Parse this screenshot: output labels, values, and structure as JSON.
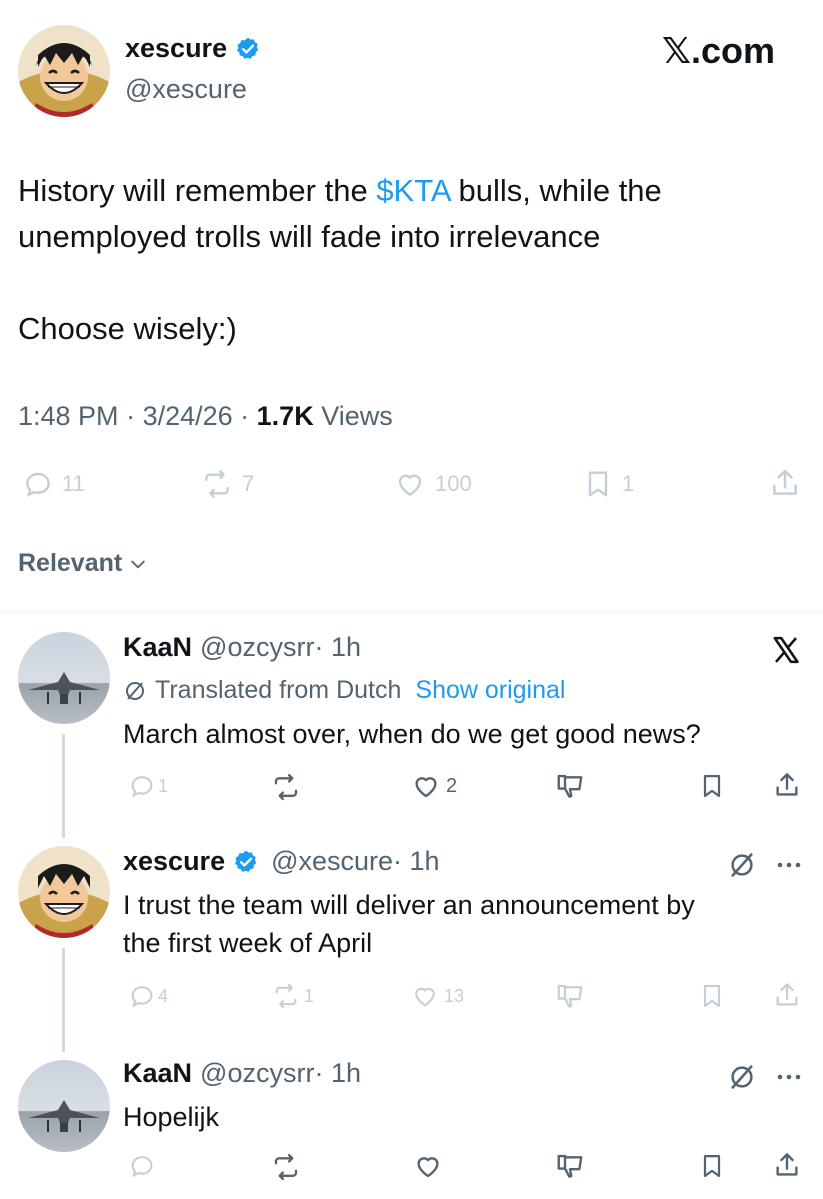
{
  "main_tweet": {
    "author": {
      "name": "xescure",
      "handle": "@xescure"
    },
    "site_label": "𝕏.com",
    "text": {
      "line1_before": "History will remember the ",
      "cashtag": "$KTA",
      "line1_after": " bulls, while the",
      "line2": "unemployed trolls will fade into irrelevance",
      "line3": "Choose wisely:)"
    },
    "meta": {
      "time": "1:48 PM",
      "sep1": " · ",
      "date": "3/24/26",
      "sep2": " · ",
      "views_count": "1.7K",
      "views_label": " Views"
    },
    "actions": {
      "replies": "11",
      "reposts": "7",
      "likes": "100",
      "bookmarks": "1"
    }
  },
  "sort": {
    "label": "Relevant"
  },
  "replies": [
    {
      "name": "KaaN",
      "handle": "@ozcysrr",
      "time": " · 1h",
      "translated_label": "Translated from Dutch",
      "show_original": "Show original",
      "text": "March almost over, when do we get good news?",
      "actions": {
        "replies": "1",
        "reposts": "",
        "likes": "2"
      }
    },
    {
      "name": "xescure",
      "handle": "@xescure",
      "time": " · 1h",
      "text_line1": "I trust the team will deliver an announcement by",
      "text_line2": "the first week of April",
      "actions": {
        "replies": "4",
        "reposts": "1",
        "likes": "13"
      }
    },
    {
      "name": "KaaN",
      "handle": "@ozcysrr",
      "time": " · 1h",
      "text": "Hopelijk",
      "actions": {
        "replies": "",
        "reposts": "",
        "likes": ""
      }
    }
  ],
  "colors": {
    "link_blue": "#1d9bf0",
    "text": "#0f1419",
    "secondary": "#536471",
    "faded_icon": "#c4cfd6",
    "verified": "#1d9bf0"
  }
}
